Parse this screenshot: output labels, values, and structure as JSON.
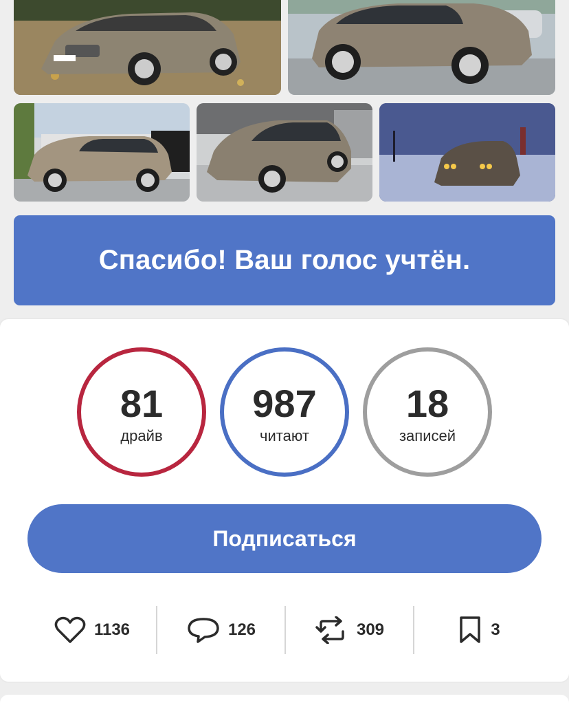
{
  "photos": [
    {
      "name": "car-photo-1",
      "palette": "autumn"
    },
    {
      "name": "car-photo-2",
      "palette": "parking"
    },
    {
      "name": "car-photo-3",
      "palette": "garage"
    },
    {
      "name": "car-photo-4",
      "palette": "wet"
    },
    {
      "name": "car-photo-5",
      "palette": "winter"
    }
  ],
  "vote": {
    "message": "Спасибо! Ваш голос учтён."
  },
  "stats": [
    {
      "value": "81",
      "label": "драйв",
      "color": "#b8263f"
    },
    {
      "value": "987",
      "label": "читают",
      "color": "#4a6fc4"
    },
    {
      "value": "18",
      "label": "записей",
      "color": "#9e9e9e"
    }
  ],
  "subscribe": {
    "label": "Подписаться"
  },
  "actions": {
    "likes": "1136",
    "comments": "126",
    "reposts": "309",
    "bookmarks": "3"
  },
  "colors": {
    "accent": "#5075c7",
    "text": "#2b2b2b"
  }
}
